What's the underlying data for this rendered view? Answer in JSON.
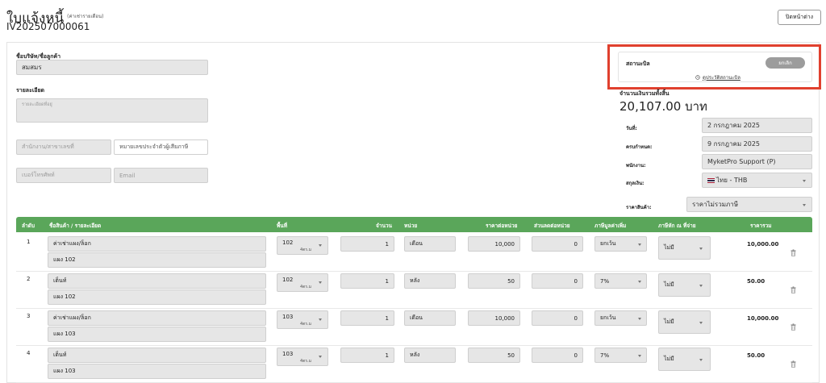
{
  "header": {
    "title": "ใบแจ้งหนี้",
    "title_note": "(ค่าเช่ารายเดือน)",
    "doc_no": "IV202507000061",
    "close_label": "ปิดหน้าต่าง"
  },
  "customer": {
    "company_label": "ชื่อบริษัท/ชื่อลูกค้า",
    "company_value": "สมสมร",
    "detail_label": "รายละเอียด",
    "detail_placeholder": "รายละเอียดที่อยู่",
    "branch_placeholder": "สำนักงาน/สาขาเลขที่",
    "tax_placeholder": "หมายเลขประจำตัวผู้เสียภาษี",
    "phone_placeholder": "เบอร์โทรศัพท์",
    "email_placeholder": "Email"
  },
  "status": {
    "label": "สถานะบิล",
    "badge": "ยกเลิก",
    "history_link": "ดูประวัติสถานะบิล"
  },
  "summary": {
    "total_label": "จำนวนเงินรวมทั้งสิ้น",
    "total_value": "20,107.00 บาท",
    "date_label": "วันที่:",
    "date_value": "2 กรกฎาคม 2025",
    "due_label": "ครบกำหนด:",
    "due_value": "9 กรกฎาคม 2025",
    "staff_label": "พนักงาน:",
    "staff_value": "MyketPro Support (P)",
    "currency_label": "สกุลเงิน:",
    "currency_value": "ไทย - THB",
    "price_type_label": "ราคาสินค้า:",
    "price_type_value": "ราคาไม่รวมภาษี"
  },
  "table": {
    "headers": {
      "no": "ลำดับ",
      "item": "ชื่อสินค้า / รายละเอียด",
      "area": "พื้นที่",
      "qty": "จำนวน",
      "unit": "หน่วย",
      "price": "ราคาต่อหน่วย",
      "discount": "ส่วนลดต่อหน่วย",
      "vat": "ภาษีมูลค่าเพิ่ม",
      "wht": "ภาษีหัก ณ ที่จ่าย",
      "total": "ราคารวม"
    },
    "rows": [
      {
        "no": "1",
        "name": "ค่าเช่าแผง/ล็อก",
        "detail": "แผง 102",
        "area": "102",
        "area_sub": "4ตร.ม",
        "qty": "1",
        "unit": "เดือน",
        "price": "10,000",
        "discount": "0",
        "vat": "ยกเว้น",
        "wht": "ไม่มี",
        "total": "10,000.00"
      },
      {
        "no": "2",
        "name": "เต็นท์",
        "detail": "แผง 102",
        "area": "102",
        "area_sub": "4ตร.ม",
        "qty": "1",
        "unit": "หลัง",
        "price": "50",
        "discount": "0",
        "vat": "7%",
        "wht": "ไม่มี",
        "total": "50.00"
      },
      {
        "no": "3",
        "name": "ค่าเช่าแผง/ล็อก",
        "detail": "แผง 103",
        "area": "103",
        "area_sub": "4ตร.ม",
        "qty": "1",
        "unit": "เดือน",
        "price": "10,000",
        "discount": "0",
        "vat": "ยกเว้น",
        "wht": "ไม่มี",
        "total": "10,000.00"
      },
      {
        "no": "4",
        "name": "เต็นท์",
        "detail": "แผง 103",
        "area": "103",
        "area_sub": "4ตร.ม",
        "qty": "1",
        "unit": "หลัง",
        "price": "50",
        "discount": "0",
        "vat": "7%",
        "wht": "ไม่มี",
        "total": "50.00"
      }
    ]
  },
  "colors": {
    "table_header": "#5aa65a",
    "highlight_frame": "#e0402e",
    "cancel_badge": "#9c9c9c"
  }
}
